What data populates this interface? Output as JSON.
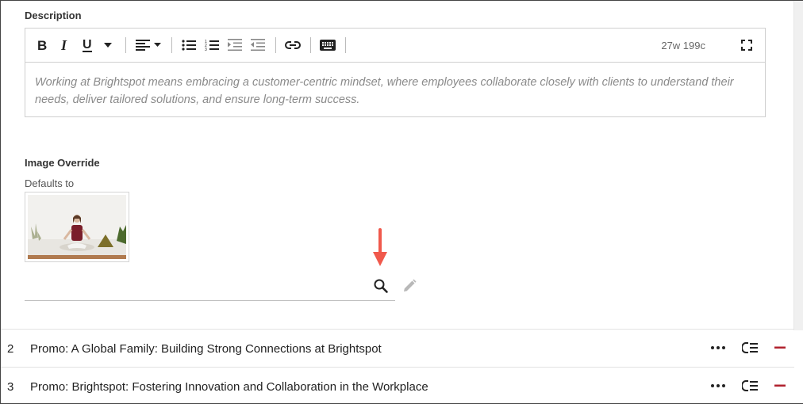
{
  "description": {
    "label": "Description",
    "toolbar": {
      "bold": "bold-button",
      "italic": "italic-button",
      "underline": "underline-button",
      "count": "27w 199c"
    },
    "text": "Working at Brightspot means embracing a customer-centric mindset, where employees collaborate closely with clients to understand their needs, deliver tailored solutions, and ensure long-term success."
  },
  "image_override": {
    "label": "Image Override",
    "defaults_label": "Defaults to"
  },
  "colors": {
    "arrow": "#f0594c",
    "remove": "#b0222e",
    "text_muted": "#8a8a8a"
  },
  "rows": [
    {
      "num": "2",
      "title": "Promo: A Global Family: Building Strong Connections at Brightspot"
    },
    {
      "num": "3",
      "title": "Promo: Brightspot: Fostering Innovation and Collaboration in the Workplace"
    }
  ]
}
